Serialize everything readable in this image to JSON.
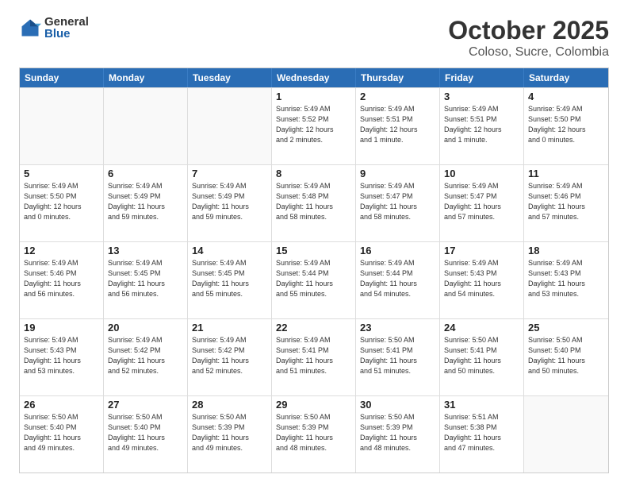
{
  "logo": {
    "general": "General",
    "blue": "Blue"
  },
  "title": "October 2025",
  "subtitle": "Coloso, Sucre, Colombia",
  "header_days": [
    "Sunday",
    "Monday",
    "Tuesday",
    "Wednesday",
    "Thursday",
    "Friday",
    "Saturday"
  ],
  "weeks": [
    [
      {
        "day": "",
        "detail": "",
        "empty": true
      },
      {
        "day": "",
        "detail": "",
        "empty": true
      },
      {
        "day": "",
        "detail": "",
        "empty": true
      },
      {
        "day": "1",
        "detail": "Sunrise: 5:49 AM\nSunset: 5:52 PM\nDaylight: 12 hours\nand 2 minutes."
      },
      {
        "day": "2",
        "detail": "Sunrise: 5:49 AM\nSunset: 5:51 PM\nDaylight: 12 hours\nand 1 minute."
      },
      {
        "day": "3",
        "detail": "Sunrise: 5:49 AM\nSunset: 5:51 PM\nDaylight: 12 hours\nand 1 minute."
      },
      {
        "day": "4",
        "detail": "Sunrise: 5:49 AM\nSunset: 5:50 PM\nDaylight: 12 hours\nand 0 minutes."
      }
    ],
    [
      {
        "day": "5",
        "detail": "Sunrise: 5:49 AM\nSunset: 5:50 PM\nDaylight: 12 hours\nand 0 minutes."
      },
      {
        "day": "6",
        "detail": "Sunrise: 5:49 AM\nSunset: 5:49 PM\nDaylight: 11 hours\nand 59 minutes."
      },
      {
        "day": "7",
        "detail": "Sunrise: 5:49 AM\nSunset: 5:49 PM\nDaylight: 11 hours\nand 59 minutes."
      },
      {
        "day": "8",
        "detail": "Sunrise: 5:49 AM\nSunset: 5:48 PM\nDaylight: 11 hours\nand 58 minutes."
      },
      {
        "day": "9",
        "detail": "Sunrise: 5:49 AM\nSunset: 5:47 PM\nDaylight: 11 hours\nand 58 minutes."
      },
      {
        "day": "10",
        "detail": "Sunrise: 5:49 AM\nSunset: 5:47 PM\nDaylight: 11 hours\nand 57 minutes."
      },
      {
        "day": "11",
        "detail": "Sunrise: 5:49 AM\nSunset: 5:46 PM\nDaylight: 11 hours\nand 57 minutes."
      }
    ],
    [
      {
        "day": "12",
        "detail": "Sunrise: 5:49 AM\nSunset: 5:46 PM\nDaylight: 11 hours\nand 56 minutes."
      },
      {
        "day": "13",
        "detail": "Sunrise: 5:49 AM\nSunset: 5:45 PM\nDaylight: 11 hours\nand 56 minutes."
      },
      {
        "day": "14",
        "detail": "Sunrise: 5:49 AM\nSunset: 5:45 PM\nDaylight: 11 hours\nand 55 minutes."
      },
      {
        "day": "15",
        "detail": "Sunrise: 5:49 AM\nSunset: 5:44 PM\nDaylight: 11 hours\nand 55 minutes."
      },
      {
        "day": "16",
        "detail": "Sunrise: 5:49 AM\nSunset: 5:44 PM\nDaylight: 11 hours\nand 54 minutes."
      },
      {
        "day": "17",
        "detail": "Sunrise: 5:49 AM\nSunset: 5:43 PM\nDaylight: 11 hours\nand 54 minutes."
      },
      {
        "day": "18",
        "detail": "Sunrise: 5:49 AM\nSunset: 5:43 PM\nDaylight: 11 hours\nand 53 minutes."
      }
    ],
    [
      {
        "day": "19",
        "detail": "Sunrise: 5:49 AM\nSunset: 5:43 PM\nDaylight: 11 hours\nand 53 minutes."
      },
      {
        "day": "20",
        "detail": "Sunrise: 5:49 AM\nSunset: 5:42 PM\nDaylight: 11 hours\nand 52 minutes."
      },
      {
        "day": "21",
        "detail": "Sunrise: 5:49 AM\nSunset: 5:42 PM\nDaylight: 11 hours\nand 52 minutes."
      },
      {
        "day": "22",
        "detail": "Sunrise: 5:49 AM\nSunset: 5:41 PM\nDaylight: 11 hours\nand 51 minutes."
      },
      {
        "day": "23",
        "detail": "Sunrise: 5:50 AM\nSunset: 5:41 PM\nDaylight: 11 hours\nand 51 minutes."
      },
      {
        "day": "24",
        "detail": "Sunrise: 5:50 AM\nSunset: 5:41 PM\nDaylight: 11 hours\nand 50 minutes."
      },
      {
        "day": "25",
        "detail": "Sunrise: 5:50 AM\nSunset: 5:40 PM\nDaylight: 11 hours\nand 50 minutes."
      }
    ],
    [
      {
        "day": "26",
        "detail": "Sunrise: 5:50 AM\nSunset: 5:40 PM\nDaylight: 11 hours\nand 49 minutes."
      },
      {
        "day": "27",
        "detail": "Sunrise: 5:50 AM\nSunset: 5:40 PM\nDaylight: 11 hours\nand 49 minutes."
      },
      {
        "day": "28",
        "detail": "Sunrise: 5:50 AM\nSunset: 5:39 PM\nDaylight: 11 hours\nand 49 minutes."
      },
      {
        "day": "29",
        "detail": "Sunrise: 5:50 AM\nSunset: 5:39 PM\nDaylight: 11 hours\nand 48 minutes."
      },
      {
        "day": "30",
        "detail": "Sunrise: 5:50 AM\nSunset: 5:39 PM\nDaylight: 11 hours\nand 48 minutes."
      },
      {
        "day": "31",
        "detail": "Sunrise: 5:51 AM\nSunset: 5:38 PM\nDaylight: 11 hours\nand 47 minutes."
      },
      {
        "day": "",
        "detail": "",
        "empty": true
      }
    ]
  ]
}
